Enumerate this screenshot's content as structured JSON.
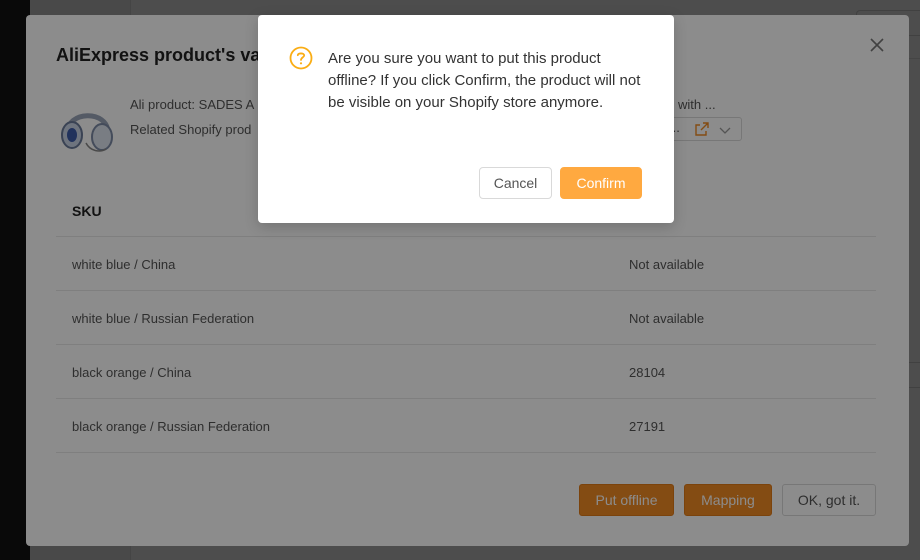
{
  "modal": {
    "title": "AliExpress product's variants",
    "ali_product_label": "Ali product: SADES A",
    "related_label": "Related Shopify prod",
    "ali_right_text": "with ...",
    "select_value": "...",
    "table": {
      "headers": {
        "sku": "SKU"
      },
      "rows": [
        {
          "sku": "white blue / China",
          "stock": "Not available"
        },
        {
          "sku": "white blue / Russian Federation",
          "stock": "Not available"
        },
        {
          "sku": "black orange / China",
          "stock": "28104"
        },
        {
          "sku": "black orange / Russian Federation",
          "stock": "27191"
        }
      ]
    },
    "buttons": {
      "put_offline": "Put offline",
      "mapping": "Mapping",
      "ok": "OK, got it."
    }
  },
  "confirm": {
    "message": "Are you sure you want to put this product offline? If you click Confirm, the product will not be visible on your Shopify store anymore.",
    "cancel_label": "Cancel",
    "confirm_label": "Confirm"
  },
  "colors": {
    "accent": "#f08a24",
    "confirm": "#ffa940",
    "warning_icon": "#faad14"
  }
}
